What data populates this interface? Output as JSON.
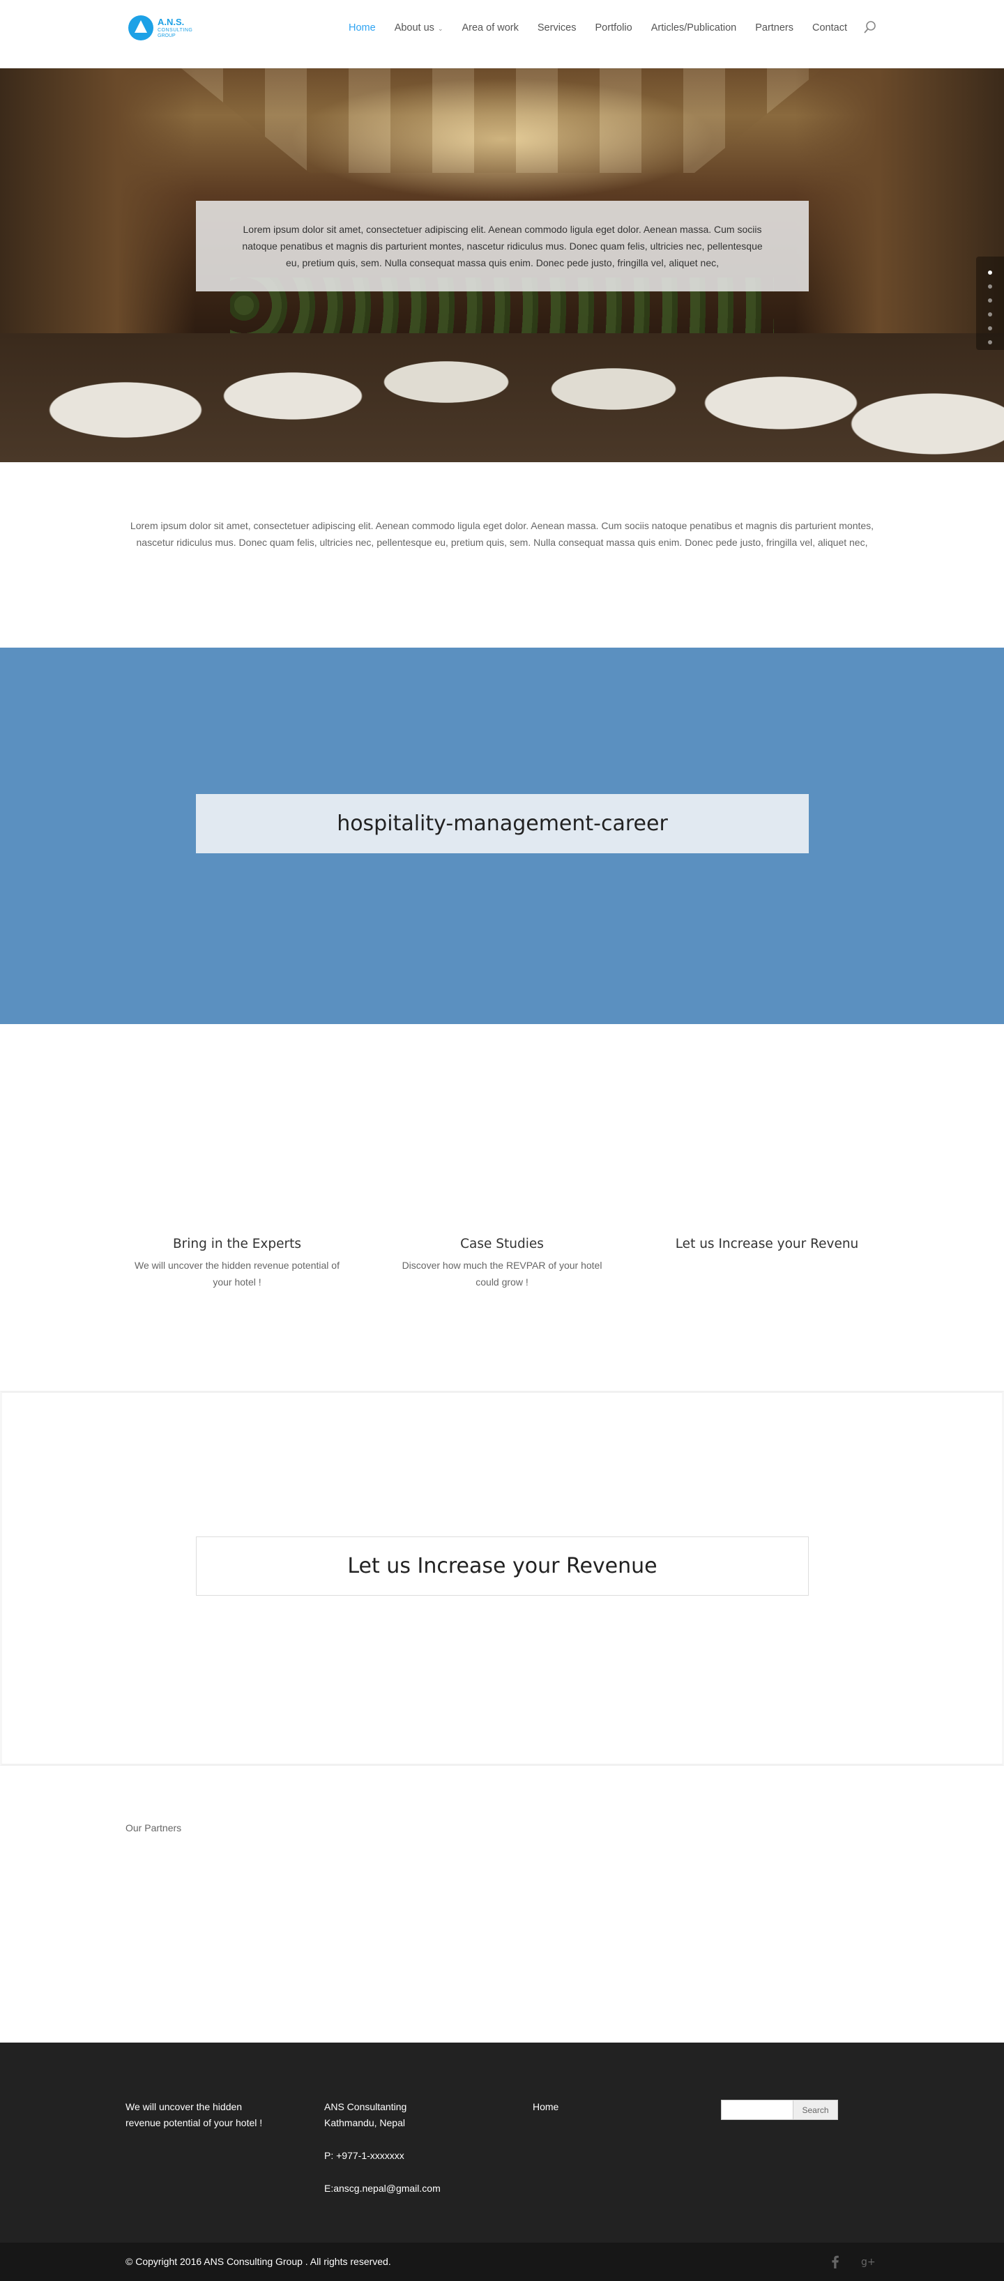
{
  "header": {
    "logo": {
      "line1": "A.N.S.",
      "line2": "CONSULTING",
      "line3": "GROUP"
    },
    "nav": [
      {
        "label": "Home",
        "active": true
      },
      {
        "label": "About us",
        "has_caret": true
      },
      {
        "label": "Area of work"
      },
      {
        "label": "Services"
      },
      {
        "label": "Portfolio"
      },
      {
        "label": "Articles/Publication"
      },
      {
        "label": "Partners"
      },
      {
        "label": "Contact"
      }
    ],
    "accent_color": "#2ea3f2"
  },
  "hero": {
    "text": "Lorem ipsum dolor sit amet, consectetuer adipiscing elit. Aenean commodo ligula eget dolor. Aenean massa. Cum sociis natoque penatibus et magnis dis parturient montes, nascetur ridiculus mus. Donec quam felis, ultricies nec, pellentesque eu, pretium quis, sem. Nulla consequat massa quis enim. Donec pede justo, fringilla vel, aliquet nec,",
    "slides_total": 6,
    "slide_active": 1
  },
  "intro": {
    "text": "Lorem ipsum dolor sit amet, consectetuer adipiscing elit. Aenean commodo ligula eget dolor. Aenean massa. Cum sociis natoque penatibus et magnis dis parturient montes, nascetur ridiculus mus. Donec quam felis, ultricies nec, pellentesque eu, pretium quis, sem. Nulla consequat massa quis enim. Donec pede justo, fringilla vel, aliquet nec,"
  },
  "blue_band": {
    "title": "hospitality-management-career",
    "color": "#5b90c0"
  },
  "features": [
    {
      "title": "Bring in the Experts",
      "text": "We will uncover the hidden revenue potential of your hotel !"
    },
    {
      "title": "Case Studies",
      "text": "Discover how much the REVPAR of your hotel could grow !"
    },
    {
      "title": "Let us Increase your Revenu",
      "text": ""
    }
  ],
  "revenue_band": {
    "title": "Let us Increase your Revenue"
  },
  "partners": {
    "label": "Our Partners"
  },
  "footer": {
    "col1": {
      "line1": "We will uncover the hidden",
      "line2": "revenue potential of your hotel !"
    },
    "col2": {
      "company": "ANS Consultanting",
      "city": "Kathmandu, Nepal",
      "phone": "P: +977-1-xxxxxxx",
      "email": "E:anscg.nepal@gmail.com"
    },
    "col3": {
      "link": "Home"
    },
    "search": {
      "placeholder": "",
      "button": "Search"
    },
    "copyright": "© Copyright 2016 ANS Consulting Group . All rights reserved.",
    "social": [
      "facebook-icon",
      "google-plus-icon"
    ]
  }
}
